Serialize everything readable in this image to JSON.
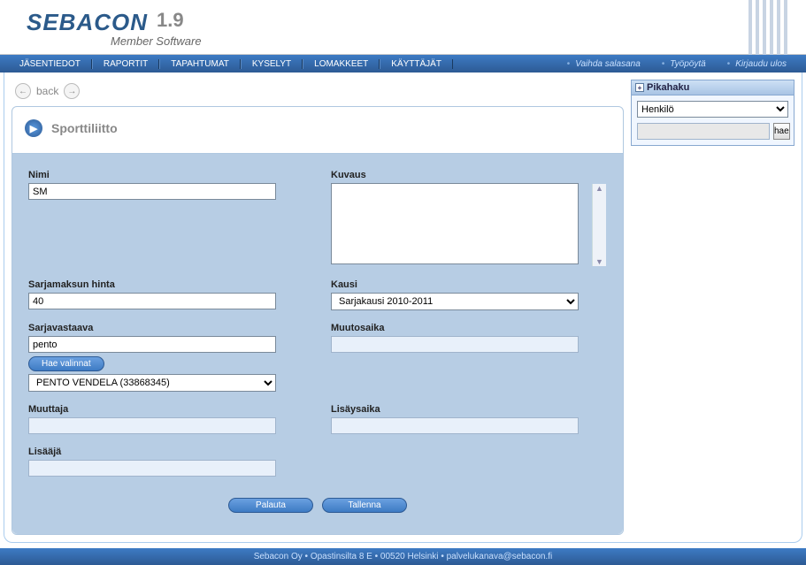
{
  "brand": {
    "name": "SEBACON",
    "version": "1.9",
    "sub": "Member Software"
  },
  "nav": {
    "items": [
      "JÄSENTIEDOT",
      "RAPORTIT",
      "TAPAHTUMAT",
      "KYSELYT",
      "LOMAKKEET",
      "KÄYTTÄJÄT"
    ],
    "right": [
      "Vaihda salasana",
      "Työpöytä",
      "Kirjaudu ulos"
    ]
  },
  "back": {
    "label": "back"
  },
  "page": {
    "title": "Sporttiliitto",
    "fields": {
      "nimi_label": "Nimi",
      "nimi_value": "SM",
      "kuvaus_label": "Kuvaus",
      "kuvaus_value": "",
      "sarjamaksu_label": "Sarjamaksun hinta",
      "sarjamaksu_value": "40",
      "kausi_label": "Kausi",
      "kausi_value": "Sarjakausi 2010-2011",
      "sarjavastaava_label": "Sarjavastaava",
      "sarjavastaava_value": "pento",
      "hae_valinnat_label": "Hae valinnat",
      "sarjavastaava_select_value": "PENTO VENDELA (33868345)",
      "muutosaika_label": "Muutosaika",
      "muutosaika_value": "",
      "muuttaja_label": "Muuttaja",
      "muuttaja_value": "",
      "lisaysaika_label": "Lisäysaika",
      "lisaysaika_value": "",
      "lisaaja_label": "Lisääjä",
      "lisaaja_value": ""
    },
    "buttons": {
      "reset": "Palauta",
      "save": "Tallenna"
    }
  },
  "quicksearch": {
    "title": "Pikahaku",
    "type_value": "Henkilö",
    "search_value": "",
    "go": "hae"
  },
  "footer": {
    "company": "Sebacon Oy",
    "address": "Opastinsilta 8 E",
    "postal": "00520 Helsinki",
    "email": "palvelukanava@sebacon.fi"
  }
}
